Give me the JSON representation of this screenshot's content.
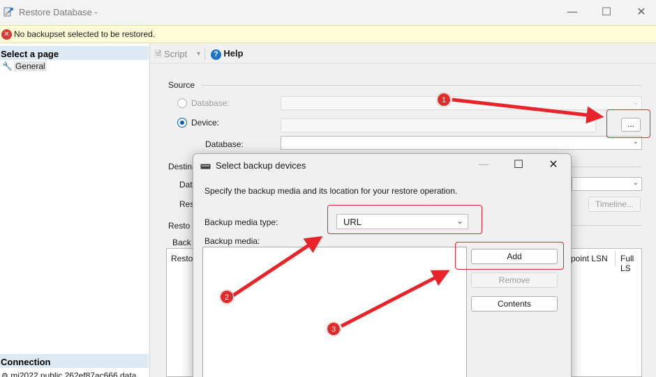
{
  "window": {
    "title": "Restore Database -"
  },
  "error": {
    "message": "No backupset selected to be restored."
  },
  "left_panel": {
    "select_page_header": "Select a page",
    "pages": [
      {
        "label": "General"
      }
    ],
    "connection_header": "Connection",
    "connection_item": "mi2022.public.262ef87ac666.data"
  },
  "toolbar": {
    "script_label": "Script",
    "help_label": "Help"
  },
  "source": {
    "label": "Source",
    "database_radio_label": "Database:",
    "device_radio_label": "Device:",
    "device_browse_label": "...",
    "database_label": "Database:"
  },
  "destination": {
    "label_partial": "Destina",
    "database_partial": "Dat",
    "restore_to_partial": "Res",
    "timeline_label": "Timeline..."
  },
  "restore_plan": {
    "label_partial": "Resto",
    "backup_sets_partial": "Back",
    "columns_partial": [
      "Resto",
      "point LSN",
      "Full LS"
    ]
  },
  "dialog": {
    "title": "Select backup devices",
    "instruction": "Specify the backup media and its location for your restore operation.",
    "media_type_label": "Backup media type:",
    "media_type_value": "URL",
    "backup_media_label": "Backup media:",
    "add_label": "Add",
    "remove_label": "Remove",
    "contents_label": "Contents"
  },
  "annotations": [
    "1",
    "2",
    "3"
  ],
  "colors": {
    "annotation_red": "#e8232a",
    "radio_blue": "#0a5fb0",
    "panel_header": "#dde9f3",
    "error_bg": "#fefcd9"
  }
}
